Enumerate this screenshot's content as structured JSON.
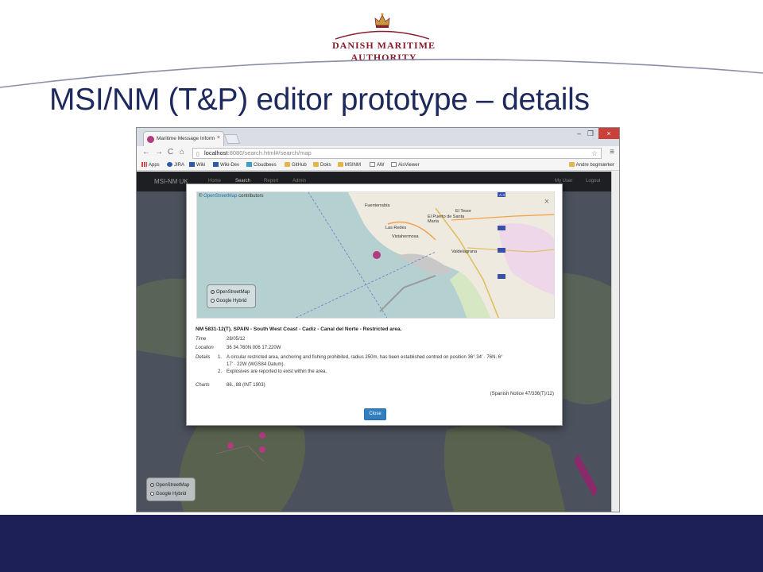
{
  "header": {
    "logo_text": "DANISH MARITIME AUTHORITY",
    "slide_title": "MSI/NM (T&P) editor prototype – details"
  },
  "browser": {
    "tab_title": "Maritime Message Inform",
    "tab_close": "×",
    "url_host": "localhost",
    "url_rest": ":8080/search.html#/search/map",
    "window_controls": [
      "‒",
      "❐"
    ],
    "window_close": "×",
    "nav": {
      "back": "←",
      "forward": "→",
      "reload": "C",
      "home": "⌂"
    },
    "bookmarks": [
      {
        "label": "Apps",
        "icon": "apps-icon"
      },
      {
        "label": "JIRA",
        "icon": "jira-icon"
      },
      {
        "label": "Wiki",
        "icon": "wiki-icon"
      },
      {
        "label": "Wiki-Dev",
        "icon": "wiki-icon"
      },
      {
        "label": "Cloudbees",
        "icon": "cloudbees-icon"
      },
      {
        "label": "GitHub",
        "icon": "folder-icon"
      },
      {
        "label": "Doks",
        "icon": "folder-icon"
      },
      {
        "label": "MSINM",
        "icon": "folder-icon"
      },
      {
        "label": "AW",
        "icon": "page-icon"
      },
      {
        "label": "AisViewer",
        "icon": "page-icon"
      }
    ],
    "other_bookmarks": "Andre bogmærker"
  },
  "app": {
    "brand": "MSI-NM UK",
    "nav": [
      "Home",
      "Search",
      "Report",
      "Admin"
    ],
    "active_nav": "Search",
    "user_links": [
      "My User",
      "Logout"
    ]
  },
  "layers": {
    "options": [
      "OpenStreetMap",
      "Google Hybrid"
    ],
    "selected": "OpenStreetMap"
  },
  "modal": {
    "attribution_prefix": "© ",
    "attribution_link": "OpenStreetMap",
    "attribution_suffix": " contributors",
    "close_x": "×",
    "places": [
      "Fuenterrabía",
      "El Puerto de Santa María",
      "El Tesor",
      "Las Redes",
      "Vistahermosa",
      "Valdelagrana",
      "A-4"
    ],
    "title": "NM 5831-12(T). SPAIN - South West Coast - Cadiz - Canal del Norte - Restricted area.",
    "time_label": "Time",
    "time_value": "28/05/12",
    "location_label": "Location",
    "location_value": "36 34.760N 006 17.220W",
    "details_label": "Details",
    "details": [
      {
        "num": "1.",
        "lines": [
          "A circular restricted area, anchoring and fishing prohibited, radius 250m, has been established centred on position 36° 34' · 76N. 6°",
          "17' · 22W  (WGS84 Datum)."
        ]
      },
      {
        "num": "2.",
        "lines": [
          "Explosives are reported to exist within the area."
        ]
      }
    ],
    "charts_label": "Charts",
    "charts_value": "86., 88 (INT 1903)",
    "notice": "(Spanish Notice 47/336(T)/12)",
    "close_label": "Close"
  },
  "colors": {
    "title": "#1f2a5c",
    "logo": "#8a1c2b",
    "footer": "#1d1f57",
    "close_button": "#2f7fc1",
    "marker": "#b33a7d"
  }
}
